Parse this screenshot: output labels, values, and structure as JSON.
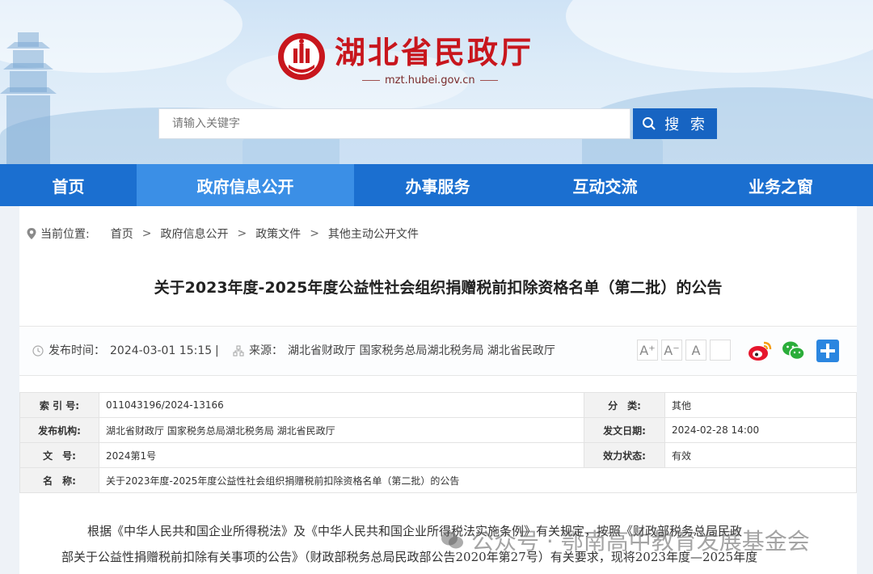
{
  "site": {
    "title": "湖北省民政厅",
    "url": "mzt.hubei.gov.cn",
    "search_placeholder": "请输入关键字",
    "search_button": "搜 索"
  },
  "nav": [
    {
      "label": "首页",
      "active": false
    },
    {
      "label": "政府信息公开",
      "active": true
    },
    {
      "label": "办事服务",
      "active": false
    },
    {
      "label": "互动交流",
      "active": false
    },
    {
      "label": "业务之窗",
      "active": false
    }
  ],
  "breadcrumb": {
    "lead": "当前位置:",
    "items": [
      "首页",
      "政府信息公开",
      "政策文件",
      "其他主动公开文件"
    ],
    "separator": ">"
  },
  "article": {
    "title": "关于2023年度-2025年度公益性社会组织捐赠税前扣除资格名单（第二批）的公告",
    "publish_label": "发布时间：",
    "publish_time": "2024-03-01 15:15",
    "divider": "|",
    "source_label": "来源：",
    "source": "湖北省财政厅 国家税务总局湖北税务局 湖北省民政厅",
    "font_buttons": [
      "A⁺",
      "A⁻",
      "A",
      ""
    ]
  },
  "info_table": {
    "index_label": "索 引 号:",
    "index_value": "011043196/2024-13166",
    "category_label": "分　类:",
    "category_value": "其他",
    "org_label": "发布机构:",
    "org_value": "湖北省财政厅 国家税务总局湖北税务局 湖北省民政厅",
    "date_label": "发文日期:",
    "date_value": "2024-02-28 14:00",
    "docno_label": "文　号:",
    "docno_value": "2024第1号",
    "status_label": "效力状态:",
    "status_value": "有效",
    "name_label": "名　称:",
    "name_value": "关于2023年度-2025年度公益性社会组织捐赠税前扣除资格名单（第二批）的公告"
  },
  "body": {
    "line1": "根据《中华人民共和国企业所得税法》及《中华人民共和国企业所得税法实施条例》有关规定，按照《财政部税务总局民政",
    "line2": "部关于公益性捐赠税前扣除有关事项的公告》（财政部税务总局民政部公告2020年第27号）有关要求，现将2023年度—2025年度"
  },
  "watermark": "公众号 · 鄂南高中教育发展基金会",
  "colors": {
    "brand_red": "#c8161d",
    "nav_blue": "#1b6fd0",
    "nav_active": "#3b8fe6",
    "search_blue": "#1764c2"
  }
}
